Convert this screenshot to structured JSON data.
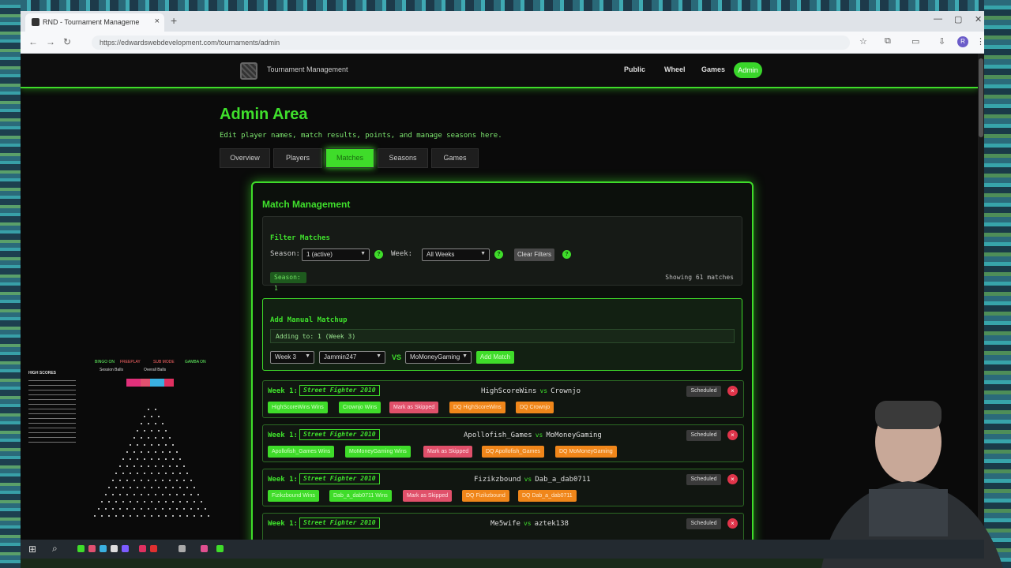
{
  "browser": {
    "tab_title": "RND - Tournament Manageme",
    "url": "https://edwardswebdevelopment.com/tournaments/admin",
    "profile_initial": "R"
  },
  "site": {
    "brand": "Tournament Management",
    "nav": [
      "Public",
      "Wheel",
      "Games",
      "Admin"
    ]
  },
  "admin": {
    "title": "Admin Area",
    "subtitle": "Edit player names, match results, points, and manage seasons here.",
    "tabs": [
      "Overview",
      "Players",
      "Matches",
      "Seasons",
      "Games"
    ],
    "active_tab": "Matches"
  },
  "match_mgmt": {
    "title": "Match Management",
    "filter": {
      "title": "Filter Matches",
      "season_label": "Season:",
      "season_value": "1 (active)",
      "week_label": "Week:",
      "week_value": "All Weeks",
      "clear_label": "Clear Filters",
      "season_badge": "Season: 1",
      "showing": "Showing 61 matches"
    },
    "manual": {
      "title": "Add Manual Matchup",
      "adding_to": "Adding to: 1 (Week 3)",
      "week_select": "Week 3",
      "player1": "Jammin247",
      "vs": "VS",
      "player2": "MoMoneyGaming",
      "add_label": "Add Match"
    },
    "matches": [
      {
        "week": "Week 1:",
        "game": "Street Fighter 2010",
        "p1": "HighScoreWins",
        "vs": "vs",
        "p2": "Crownjo",
        "status": "Scheduled",
        "buttons": [
          "HighScoreWins Wins",
          "Crownjo Wins",
          "Mark as Skipped",
          "DQ HighScoreWins",
          "DQ Crownjo"
        ]
      },
      {
        "week": "Week 1:",
        "game": "Street Fighter 2010",
        "p1": "Apollofish_Games",
        "vs": "vs",
        "p2": "MoMoneyGaming",
        "status": "Scheduled",
        "buttons": [
          "Apollofish_Games Wins",
          "MoMoneyGaming Wins",
          "Mark as Skipped",
          "DQ Apollofish_Games",
          "DQ MoMoneyGaming"
        ]
      },
      {
        "week": "Week 1:",
        "game": "Street Fighter 2010",
        "p1": "Fizikzbound",
        "vs": "vs",
        "p2": "Dab_a_dab0711",
        "status": "Scheduled",
        "buttons": [
          "Fizikzbound Wins",
          "Dab_a_dab0711 Wins",
          "Mark as Skipped",
          "DQ Fizikzbound",
          "DQ Dab_a_dab0711"
        ]
      },
      {
        "week": "Week 1:",
        "game": "Street Fighter 2010",
        "p1": "Me5wife",
        "vs": "vs",
        "p2": "aztek138",
        "status": "Scheduled",
        "buttons": []
      }
    ]
  },
  "overlay": {
    "labels": [
      "HIGH SCORES",
      "BINGO ON",
      "FREEPLAY",
      "SUB MODE",
      "GAMBA ON",
      "Session Balls",
      "Overall Balls"
    ]
  },
  "colors": {
    "accent": "#3fdc2a",
    "danger": "#e0506a",
    "warning": "#f0861a"
  }
}
